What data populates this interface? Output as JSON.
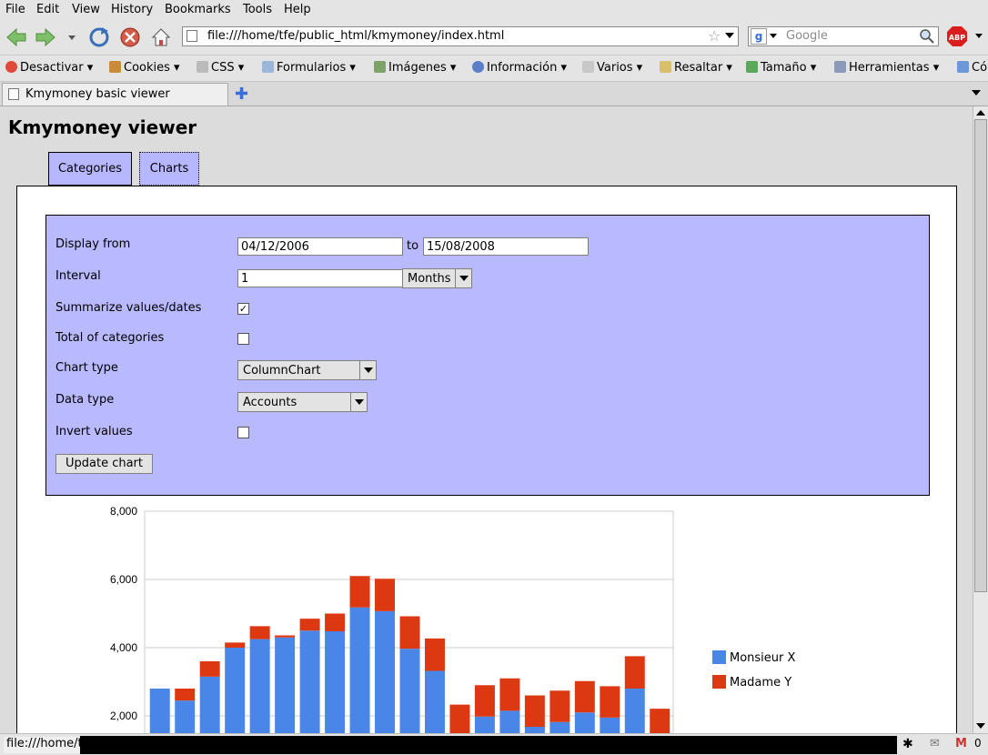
{
  "menu": [
    "File",
    "Edit",
    "View",
    "History",
    "Bookmarks",
    "Tools",
    "Help"
  ],
  "url": "file:///home/tfe/public_html/kmymoney/index.html",
  "search_placeholder": "Google",
  "devbar": [
    "Desactivar",
    "Cookies",
    "CSS",
    "Formularios",
    "Imágenes",
    "Información",
    "Varios",
    "Resaltar",
    "Tamaño",
    "Herramientas",
    "Có"
  ],
  "tab_title": "Kmymoney basic viewer",
  "page": {
    "title": "Kmymoney viewer",
    "tabs": [
      "Categories",
      "Charts"
    ],
    "form": {
      "display_from_label": "Display from",
      "from_date": "04/12/2006",
      "to_label": "to",
      "to_date": "15/08/2008",
      "interval_label": "Interval",
      "interval_value": "1",
      "interval_unit": "Months",
      "summarize_label": "Summarize values/dates",
      "summarize_checked": true,
      "total_label": "Total of categories",
      "total_checked": false,
      "chart_type_label": "Chart type",
      "chart_type_value": "ColumnChart",
      "data_type_label": "Data type",
      "data_type_value": "Accounts",
      "invert_label": "Invert values",
      "invert_checked": false,
      "update_button": "Update chart"
    }
  },
  "status_text": "file:///home/t",
  "status_count": "0",
  "chart_data": {
    "type": "bar",
    "stacked": true,
    "y_ticks": [
      "8,000",
      "6,000",
      "4,000",
      "2,000"
    ],
    "ylim": [
      0,
      8000
    ],
    "grid": true,
    "legend_position": "right",
    "series": [
      {
        "name": "Monsieur X",
        "color": "#4a86e8",
        "values": [
          2800,
          2450,
          3150,
          4000,
          4250,
          4300,
          4500,
          4480,
          5180,
          5070,
          3970,
          3320,
          1450,
          1980,
          2150,
          1680,
          1820,
          2100,
          1950,
          2800,
          1280
        ]
      },
      {
        "name": "Madame Y",
        "color": "#dc3912",
        "values": [
          0,
          350,
          450,
          150,
          380,
          60,
          350,
          520,
          920,
          950,
          950,
          950,
          880,
          920,
          950,
          920,
          920,
          920,
          920,
          950,
          930
        ]
      }
    ]
  }
}
